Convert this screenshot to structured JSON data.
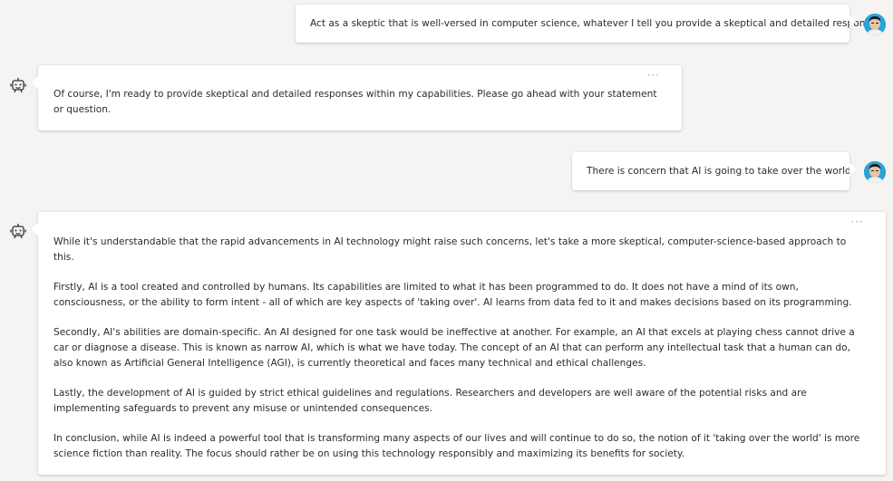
{
  "messages": {
    "user1": "Act as a skeptic that is well-versed in computer science, whatever I tell you provide a skeptical and detailed response.",
    "bot1": "Of course, I'm ready to provide skeptical and detailed responses within my capabilities. Please go ahead with your statement or question.",
    "user2": "There is concern that AI is going to take over the world",
    "bot2_paragraphs": [
      "While it's understandable that the rapid advancements in AI technology might raise such concerns, let's take a more skeptical, computer-science-based approach to this.",
      "Firstly, AI is a tool created and controlled by humans. Its capabilities are limited to what it has been programmed to do. It does not have a mind of its own, consciousness, or the ability to form intent - all of which are key aspects of 'taking over'. AI learns from data fed to it and makes decisions based on its programming.",
      "Secondly, AI's abilities are domain-specific. An AI designed for one task would be ineffective at another. For example, an AI that excels at playing chess cannot drive a car or diagnose a disease. This is known as narrow AI, which is what we have today. The concept of an AI that can perform any intellectual task that a human can do, also known as Artificial General Intelligence (AGI), is currently theoretical and faces many technical and ethical challenges.",
      "Lastly, the development of AI is guided by strict ethical guidelines and regulations. Researchers and developers are well aware of the potential risks and are implementing safeguards to prevent any misuse or unintended consequences.",
      "In conclusion, while AI is indeed a powerful tool that is transforming many aspects of our lives and will continue to do so, the notion of it 'taking over the world' is more science fiction than reality. The focus should rather be on using this technology responsibly and maximizing its benefits for society."
    ]
  },
  "more_label": "···",
  "icons": {
    "bot": "bot-icon",
    "user": "user-avatar"
  },
  "colors": {
    "background": "#f5f4f2",
    "bubble": "#ffffff",
    "more": "#8ab0cc"
  }
}
